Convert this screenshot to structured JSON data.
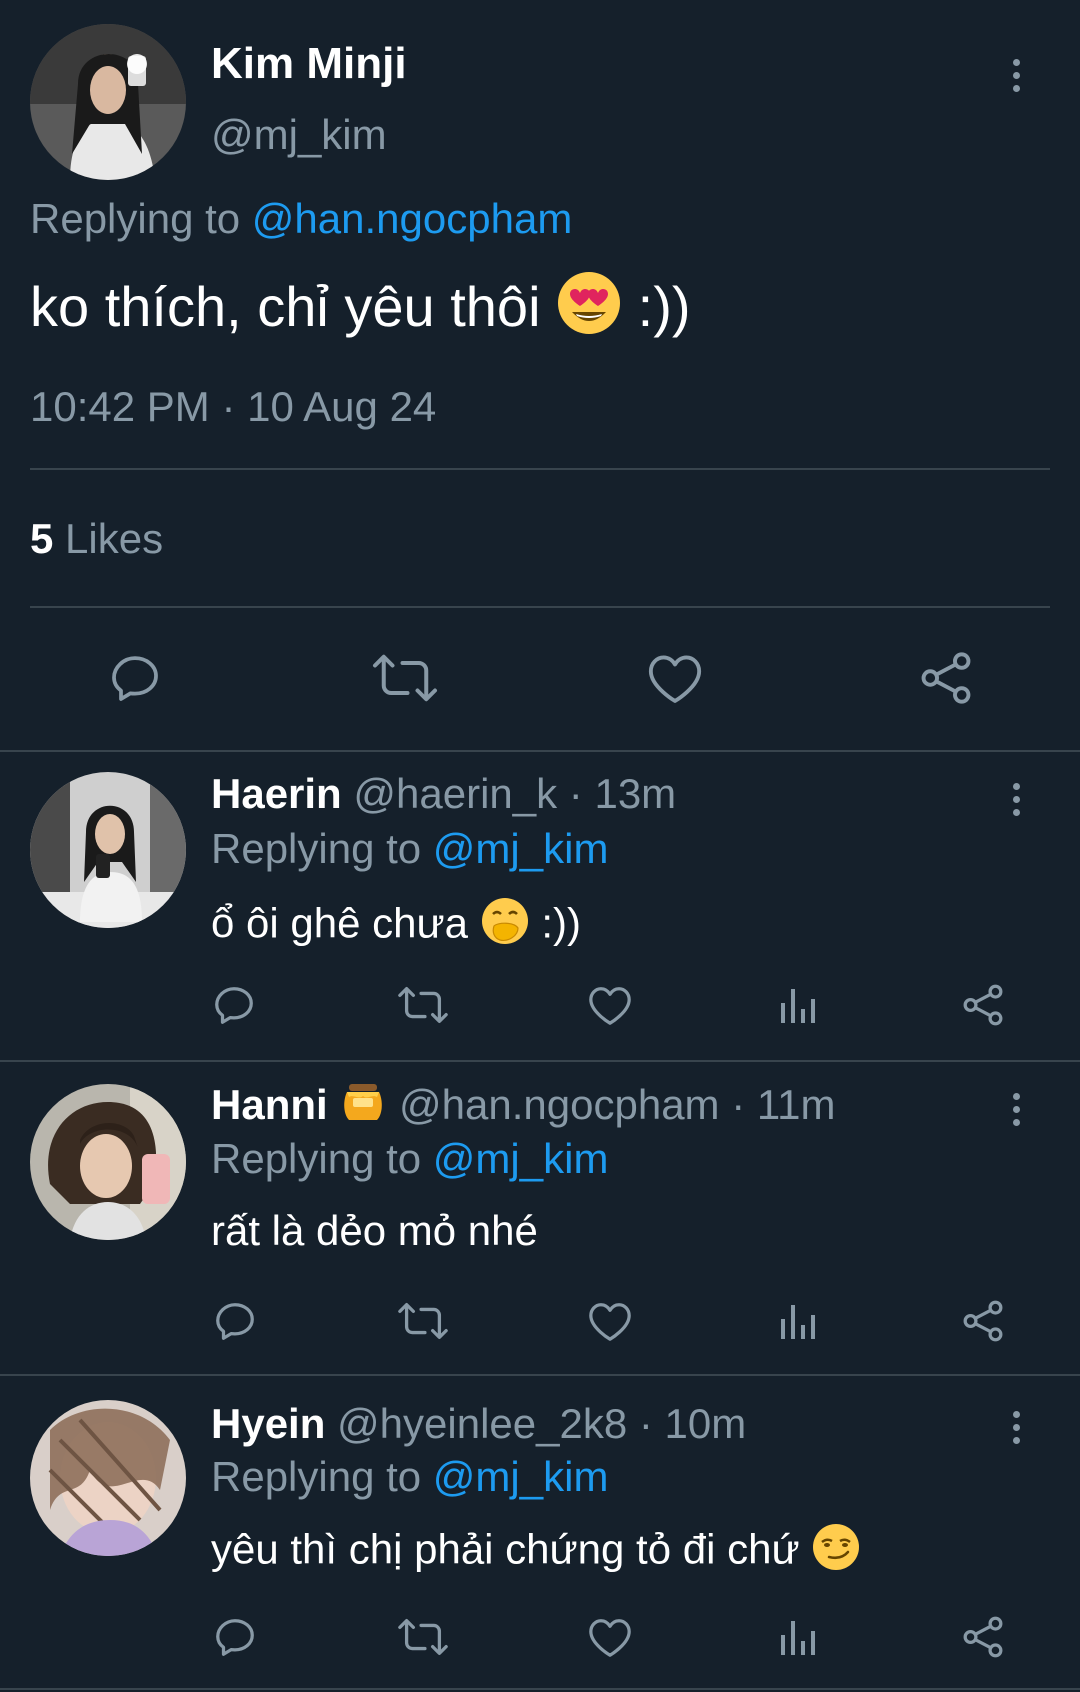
{
  "colors": {
    "background": "#15202b",
    "text": "#ffffff",
    "muted": "#8899a6",
    "link": "#1d9bf0",
    "divider": "#38444d"
  },
  "tweet": {
    "name": "Kim Minji",
    "handle": "@mj_kim",
    "replying_prefix": "Replying to",
    "replying_to": "@han.ngocpham",
    "text": "ko thích, chỉ yêu thôi",
    "text_suffix": ":))",
    "emoji": "smiling-face-with-heart-eyes",
    "timestamp": "10:42 PM · 10 Aug 24",
    "likes_count": "5",
    "likes_label": "Likes"
  },
  "replies": [
    {
      "name": "Haerin",
      "handle": "@haerin_k · 13m",
      "replying_prefix": "Replying to",
      "replying_to": "@mj_kim",
      "text": "ổ ôi ghê chưa",
      "text_suffix": ":))",
      "emoji": "face-with-hand-over-mouth"
    },
    {
      "name": "Hanni",
      "name_emoji": "honey-pot",
      "handle": "@han.ngocpham · 11m",
      "replying_prefix": "Replying to",
      "replying_to": "@mj_kim",
      "text": "rất là dẻo mỏ nhé"
    },
    {
      "name": "Hyein",
      "handle": "@hyeinlee_2k8 · 10m",
      "replying_prefix": "Replying to",
      "replying_to": "@mj_kim",
      "text": "yêu thì chị phải chứng tỏ đi chứ",
      "emoji": "smirking-face"
    }
  ]
}
